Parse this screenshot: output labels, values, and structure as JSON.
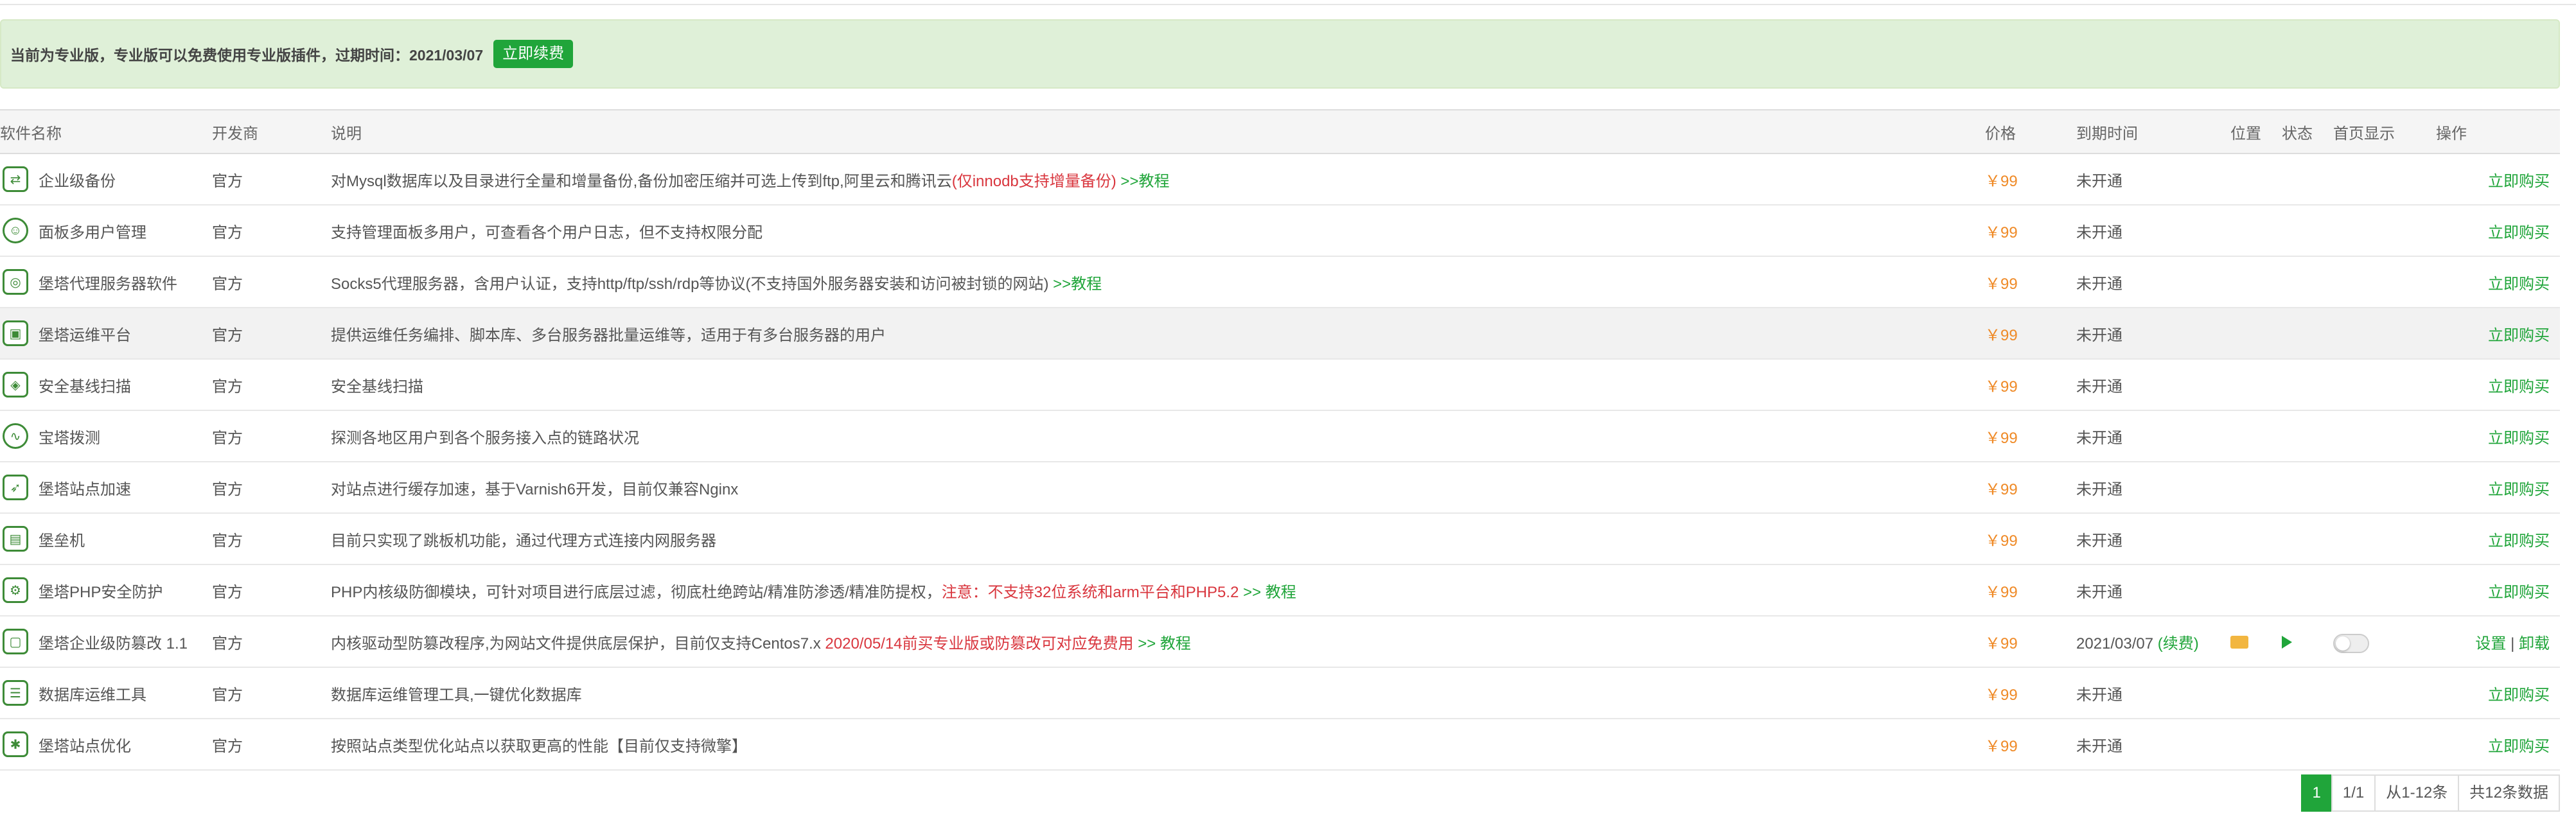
{
  "notice": {
    "text": "当前为专业版，专业版可以免费使用专业版插件，过期时间：2021/03/07",
    "button": "立即续费"
  },
  "table": {
    "headers": {
      "name": "软件名称",
      "vendor": "开发商",
      "desc": "说明",
      "price": "价格",
      "expire": "到期时间",
      "location": "位置",
      "status": "状态",
      "home": "首页显示",
      "action": "操作"
    },
    "rows": [
      {
        "name": "企业级备份",
        "icon": "backup-icon",
        "vendor": "官方",
        "desc": "对Mysql数据库以及目录进行全量和增量备份,备份加密压缩并可选上传到ftp,阿里云和腾讯云",
        "desc_red": "(仅innodb支持增量备份)",
        "desc_link": " >>教程",
        "price": "￥99",
        "expire": "未开通",
        "action": "立即购买"
      },
      {
        "name": "面板多用户管理",
        "icon": "users-icon",
        "vendor": "官方",
        "desc": "支持管理面板多用户，可查看各个用户日志，但不支持权限分配",
        "price": "￥99",
        "expire": "未开通",
        "action": "立即购买"
      },
      {
        "name": "堡塔代理服务器软件",
        "icon": "proxy-icon",
        "vendor": "官方",
        "desc": "Socks5代理服务器，含用户认证，支持http/ftp/ssh/rdp等协议(不支持国外服务器安装和访问被封锁的网站)",
        "desc_link": " >>教程",
        "price": "￥99",
        "expire": "未开通",
        "action": "立即购买"
      },
      {
        "name": "堡塔运维平台",
        "icon": "ops-icon",
        "vendor": "官方",
        "desc": "提供运维任务编排、脚本库、多台服务器批量运维等，适用于有多台服务器的用户",
        "price": "￥99",
        "expire": "未开通",
        "action": "立即购买"
      },
      {
        "name": "安全基线扫描",
        "icon": "shield-icon",
        "vendor": "官方",
        "desc": "安全基线扫描",
        "price": "￥99",
        "expire": "未开通",
        "action": "立即购买"
      },
      {
        "name": "宝塔拨测",
        "icon": "pulse-icon",
        "vendor": "官方",
        "desc": "探测各地区用户到各个服务接入点的链路状况",
        "price": "￥99",
        "expire": "未开通",
        "action": "立即购买"
      },
      {
        "name": "堡塔站点加速",
        "icon": "rocket-icon",
        "vendor": "官方",
        "desc": "对站点进行缓存加速，基于Varnish6开发，目前仅兼容Nginx",
        "price": "￥99",
        "expire": "未开通",
        "action": "立即购买"
      },
      {
        "name": "堡垒机",
        "icon": "fortress-icon",
        "vendor": "官方",
        "desc": "目前只实现了跳板机功能，通过代理方式连接内网服务器",
        "price": "￥99",
        "expire": "未开通",
        "action": "立即购买"
      },
      {
        "name": "堡塔PHP安全防护",
        "icon": "php-shield-icon",
        "vendor": "官方",
        "desc": "PHP内核级防御模块，可针对项目进行底层过滤，彻底杜绝跨站/精准防渗透/精准防提权，",
        "desc_red": "注意：不支持32位系统和arm平台和PHP5.2",
        "desc_link": " >> 教程",
        "price": "￥99",
        "expire": "未开通",
        "action": "立即购买"
      },
      {
        "name": "堡塔企业级防篡改 1.1",
        "icon": "tamper-icon",
        "vendor": "官方",
        "desc": "内核驱动型防篡改程序,为网站文件提供底层保护，目前仅支持Centos7.x ",
        "desc_red": "2020/05/14前买专业版或防篡改可对应免费用",
        "desc_link": " >> 教程",
        "price": "￥99",
        "expire": "2021/03/07",
        "expire_note": "(续费)",
        "installed": true,
        "setting": "设置",
        "sep": " | ",
        "uninstall": "卸载"
      },
      {
        "name": "数据库运维工具",
        "icon": "database-icon",
        "vendor": "官方",
        "desc": "数据库运维管理工具,一键优化数据库",
        "price": "￥99",
        "expire": "未开通",
        "action": "立即购买"
      },
      {
        "name": "堡塔站点优化",
        "icon": "optimize-icon",
        "vendor": "官方",
        "desc": "按照站点类型优化站点以获取更高的性能【目前仅支持微擎】",
        "price": "￥99",
        "expire": "未开通",
        "action": "立即购买"
      }
    ]
  },
  "pager": {
    "current": "1",
    "pages": "1/1",
    "range": "从1-12条",
    "total": "共12条数据"
  },
  "colors": {
    "accent": "#20a53a",
    "price": "#ef8a27",
    "warn": "#d9363e",
    "notice_bg": "#dff0d8"
  }
}
